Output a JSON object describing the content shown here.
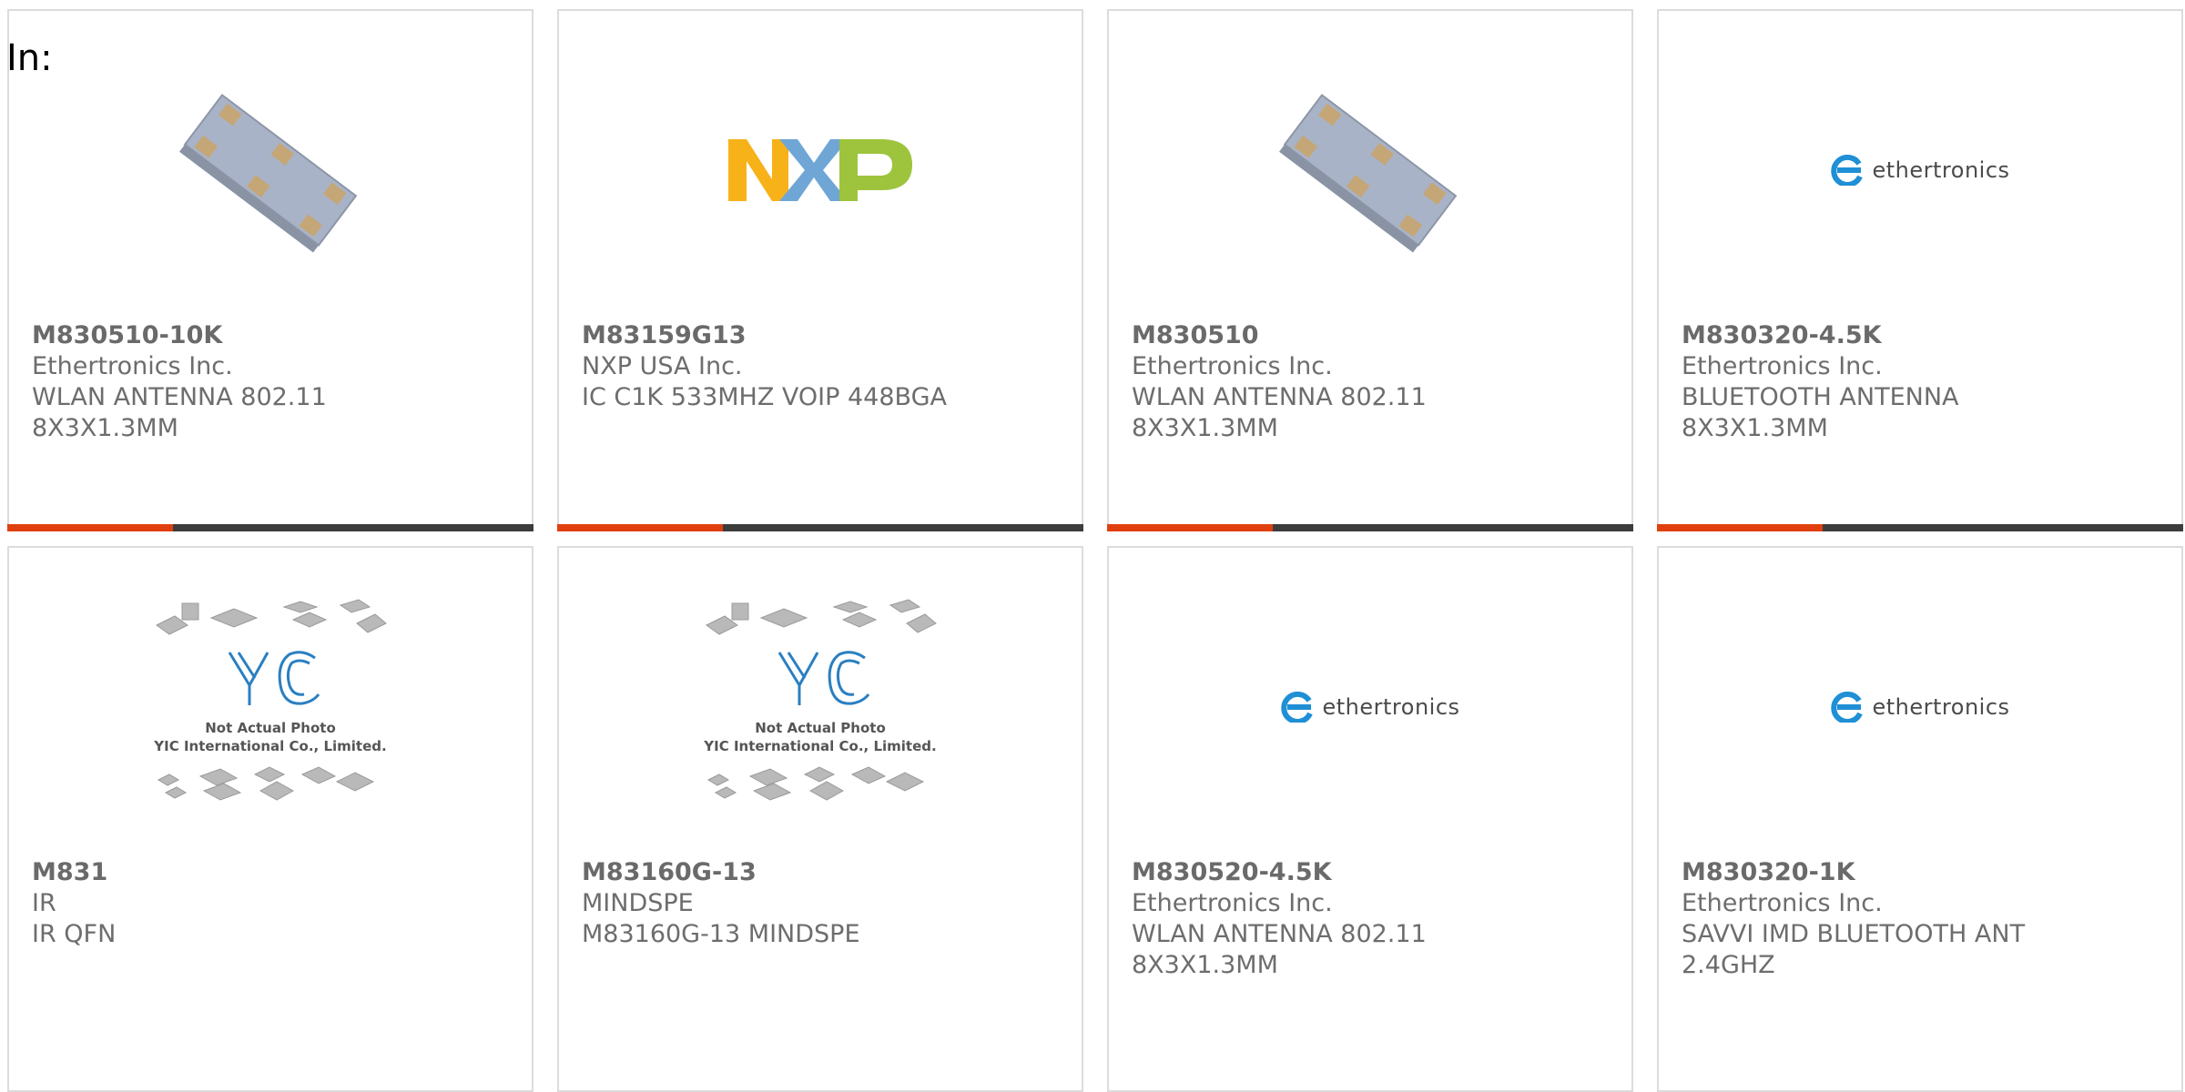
{
  "header": {
    "in_label": "In:"
  },
  "colors": {
    "accent": "#e0400f",
    "bar_dark": "#3c3c3c",
    "text": "#6d6d6d",
    "border": "#dcdcdc"
  },
  "products": [
    {
      "part": "M830510-10K",
      "manufacturer": "Ethertronics Inc.",
      "desc1": "WLAN ANTENNA 802.11",
      "desc2": "8X3X1.3MM",
      "image": "antenna-chip-photo"
    },
    {
      "part": "M83159G13",
      "manufacturer": "NXP USA Inc.",
      "desc1": "IC C1K 533MHZ VOIP 448BGA",
      "desc2": "",
      "image": "nxp-logo",
      "logo_text": "NXP"
    },
    {
      "part": "M830510",
      "manufacturer": "Ethertronics Inc.",
      "desc1": "WLAN ANTENNA 802.11",
      "desc2": "8X3X1.3MM",
      "image": "antenna-chip-photo"
    },
    {
      "part": "M830320-4.5K",
      "manufacturer": "Ethertronics Inc.",
      "desc1": "BLUETOOTH ANTENNA",
      "desc2": "8X3X1.3MM",
      "image": "ethertronics-logo",
      "logo_text": "ethertronics"
    },
    {
      "part": "M831",
      "manufacturer": "IR",
      "desc1": "IR QFN",
      "desc2": "",
      "image": "yic-placeholder",
      "placeholder_line1": "Not Actual Photo",
      "placeholder_line2": "YIC International Co., Limited."
    },
    {
      "part": "M83160G-13",
      "manufacturer": "MINDSPE",
      "desc1": "M83160G-13 MINDSPE",
      "desc2": "",
      "image": "yic-placeholder",
      "placeholder_line1": "Not Actual Photo",
      "placeholder_line2": "YIC International Co., Limited."
    },
    {
      "part": "M830520-4.5K",
      "manufacturer": "Ethertronics Inc.",
      "desc1": "WLAN ANTENNA 802.11",
      "desc2": "8X3X1.3MM",
      "image": "ethertronics-logo",
      "logo_text": "ethertronics"
    },
    {
      "part": "M830320-1K",
      "manufacturer": "Ethertronics Inc.",
      "desc1": "SAVVI IMD BLUETOOTH ANT",
      "desc2": "2.4GHZ",
      "image": "ethertronics-logo",
      "logo_text": "ethertronics"
    }
  ]
}
